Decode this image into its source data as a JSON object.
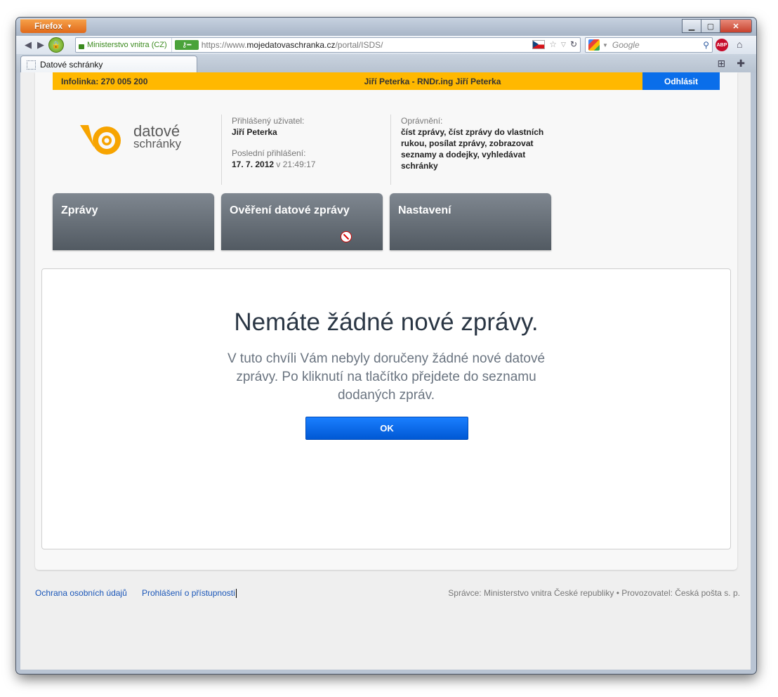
{
  "browser": {
    "menu_button": "Firefox",
    "identity_label": "Ministerstvo vnitra (CZ)",
    "url_prefix": "https://www.",
    "url_domain": "mojedatovaschranka.cz",
    "url_path": "/portal/ISDS/",
    "search_placeholder": "Google",
    "tab_title": "Datové schránky",
    "abp_label": "ABP"
  },
  "topbar": {
    "infoline": "Infolinka: 270 005 200",
    "user": "Jiří Peterka - RNDr.ing Jiří Peterka",
    "logout": "Odhlásit"
  },
  "logo": {
    "line1": "datové",
    "line2": "schránky"
  },
  "user_info": {
    "logged_label": "Přihlášený uživatel:",
    "logged_name": "Jiří Peterka",
    "last_login_label": "Poslední přihlášení:",
    "last_login_date": "17. 7. 2012",
    "last_login_time": "v 21:49:17",
    "permissions_label": "Oprávnění:",
    "permissions": "číst zprávy, číst zprávy do vlastních rukou, posílat zprávy, zobrazovat seznamy a dodejky, vyhledávat schránky"
  },
  "tiles": [
    {
      "label": "Zprávy"
    },
    {
      "label": "Ověření datové zprávy"
    },
    {
      "label": "Nastavení"
    }
  ],
  "dialog": {
    "title": "Nemáte žádné nové zprávy.",
    "text": "V tuto chvíli Vám nebyly doručeny žádné nové datové zprávy. Po kliknutí na tlačítko přejdete do seznamu dodaných zpráv.",
    "ok": "OK"
  },
  "footer": {
    "privacy": "Ochrana osobních údajů",
    "accessibility": "Prohlášení o přístupnosti",
    "admin": "Správce: Ministerstvo vnitra České republiky • Provozovatel: Česká pošta s. p."
  },
  "colors": {
    "accent_yellow": "#ffb800",
    "button_blue": "#0a6eea",
    "logo_orange": "#f7a400"
  }
}
